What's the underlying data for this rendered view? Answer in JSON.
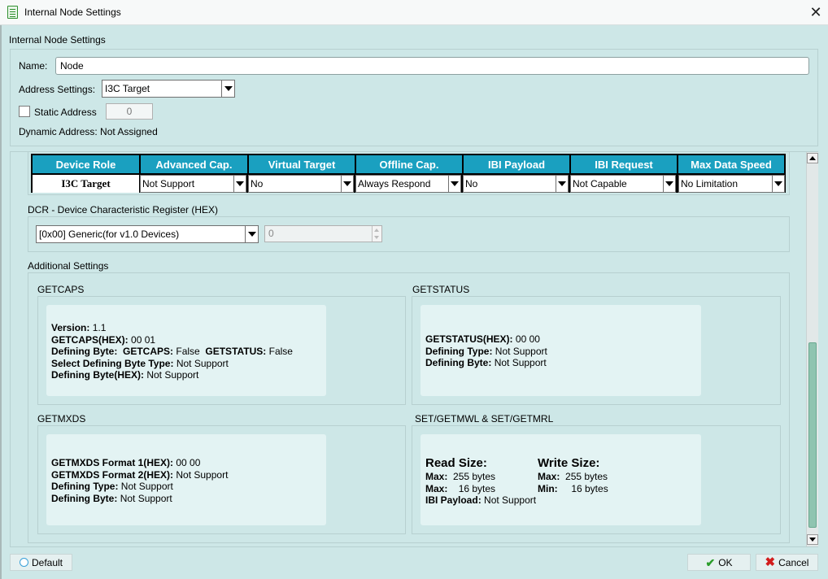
{
  "window": {
    "title": "Internal Node Settings",
    "close_glyph": "✕"
  },
  "section_title": "Internal Node Settings",
  "name_field": {
    "label": "Name:",
    "value": "Node"
  },
  "address_settings": {
    "label": "Address Settings:",
    "value": "I3C Target"
  },
  "static_address": {
    "label": "Static Address",
    "checked": false,
    "value": "0"
  },
  "dynamic_address": "Dynamic Address: Not Assigned",
  "grid": {
    "headers": [
      "Device Role",
      "Advanced Cap.",
      "Virtual Target",
      "Offline Cap.",
      "IBI Payload",
      "IBI Request",
      "Max Data Speed"
    ],
    "row": {
      "device_role": "I3C Target",
      "advanced_cap": "Not Support",
      "virtual_target": "No",
      "offline_cap": "Always Respond",
      "ibi_payload": "No",
      "ibi_request": "Not Capable",
      "max_data_speed": "No Limitation"
    },
    "header_color": "#1aa0c0"
  },
  "dcr": {
    "label": "DCR - Device Characteristic Register  (HEX)",
    "value": "[0x00] Generic(for v1.0 Devices)",
    "spin_value": "0"
  },
  "additional_settings": {
    "title": "Additional Settings",
    "getcaps": {
      "title": "GETCAPS",
      "version_label": "Version:",
      "version_value": "1.1",
      "caps_hex_label": "GETCAPS(HEX):",
      "caps_hex_value": "00 01",
      "defining_byte_label": "Defining Byte:",
      "getcaps_label": "GETCAPS:",
      "getcaps_value": "False",
      "getstatus_label": "GETSTATUS:",
      "getstatus_value": "False",
      "select_type_label": "Select Defining Byte Type:",
      "select_type_value": "Not Support",
      "def_byte_hex_label": "Defining Byte(HEX):",
      "def_byte_hex_value": "Not Support"
    },
    "getstatus": {
      "title": "GETSTATUS",
      "hex_label": "GETSTATUS(HEX):",
      "hex_value": "00 00",
      "type_label": "Defining Type:",
      "type_value": "Not Support",
      "byte_label": "Defining Byte:",
      "byte_value": "Not Support"
    },
    "getmxds": {
      "title": "GETMXDS",
      "f1_label": "GETMXDS Format 1(HEX):",
      "f1_value": "00 00",
      "f2_label": "GETMXDS Format 2(HEX):",
      "f2_value": "Not Support",
      "type_label": "Defining Type:",
      "type_value": "Not Support",
      "byte_label": "Defining Byte:",
      "byte_value": "Not Support"
    },
    "setget": {
      "title": "SET/GETMWL & SET/GETMRL",
      "read_title": "Read Size:",
      "read_max_label": "Max:",
      "read_max_value": "255 bytes",
      "read_max2_label": "Max:",
      "read_max2_value": "16 bytes",
      "ibi_label": "IBI Payload:",
      "ibi_value": "Not Support",
      "write_title": "Write Size:",
      "write_max_label": "Max:",
      "write_max_value": "255 bytes",
      "write_min_label": "Min:",
      "write_min_value": "16 bytes"
    }
  },
  "buttons": {
    "default": "Default",
    "ok": "OK",
    "cancel": "Cancel"
  }
}
